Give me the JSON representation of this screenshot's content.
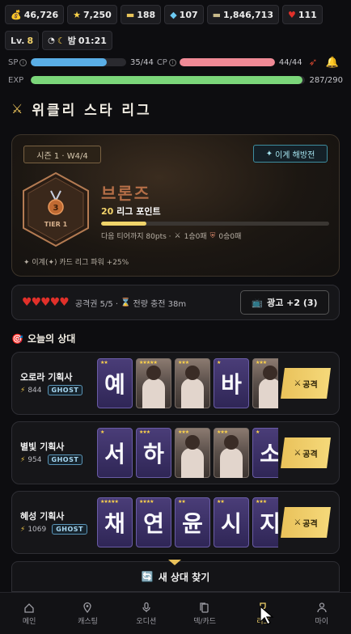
{
  "currencies": {
    "coins": "46,726",
    "stars": "7,250",
    "tickets": "188",
    "gems": "107",
    "cash": "1,846,713",
    "hearts": "111"
  },
  "level": {
    "prefix": "Lv.",
    "value": "8"
  },
  "clock": {
    "period": "밤",
    "time": "01:21"
  },
  "stats": {
    "sp": {
      "label": "SP",
      "text": "35/44",
      "fraction": 0.795,
      "color": "#5aaee6"
    },
    "cp": {
      "label": "CP",
      "text": "44/44",
      "fraction": 1.0,
      "color": "#f08a96"
    },
    "exp": {
      "label": "EXP",
      "text": "287/290",
      "fraction": 0.99,
      "color": "#7bd67a"
    }
  },
  "page": {
    "title": "위클리 스타 리그"
  },
  "league": {
    "season": "시즌 1 · W4/4",
    "ego_button": "이계 해방전",
    "tier_number": "3",
    "tier_label": "TIER 1",
    "tier_name": "브론즈",
    "points_value": "20",
    "points_label": "리그 포인트",
    "progress_fraction": 0.2,
    "next_tier": "다음 티어까지 80pts ·",
    "record1": "1승0패",
    "record2": "0승0패",
    "bonus": "✦ 이계(✦) 카드 리그 파워 +25%"
  },
  "energy": {
    "hearts_count": 5,
    "ticket_text": "공격권 5/5 ·",
    "charge_text": "전량 충전 38m",
    "ad_button": "광고 +2 (3)"
  },
  "opponents_header": "오늘의 상대",
  "opponents": [
    {
      "name": "오로라 기획사",
      "power": "844",
      "badge": "GHOST",
      "attack": "공격",
      "cards": [
        {
          "type": "letter",
          "char": "예",
          "stars": "★★"
        },
        {
          "type": "photo",
          "stars": "★★★★★"
        },
        {
          "type": "photo",
          "stars": "★★★"
        },
        {
          "type": "letter",
          "char": "바",
          "stars": "★"
        },
        {
          "type": "photo",
          "stars": "★★★"
        }
      ]
    },
    {
      "name": "별빛 기획사",
      "power": "954",
      "badge": "GHOST",
      "attack": "공격",
      "cards": [
        {
          "type": "letter",
          "char": "서",
          "stars": "★"
        },
        {
          "type": "letter",
          "char": "하",
          "stars": "★★★"
        },
        {
          "type": "photo",
          "stars": "★★★"
        },
        {
          "type": "photo",
          "stars": "★★★"
        },
        {
          "type": "letter",
          "char": "소",
          "stars": "★"
        }
      ]
    },
    {
      "name": "혜성 기획사",
      "power": "1069",
      "badge": "GHOST",
      "attack": "공격",
      "cards": [
        {
          "type": "letter",
          "char": "채",
          "stars": "★★★★★"
        },
        {
          "type": "letter",
          "char": "연",
          "stars": "★★★★"
        },
        {
          "type": "letter",
          "char": "윤",
          "stars": "★★"
        },
        {
          "type": "letter",
          "char": "시",
          "stars": "★★"
        },
        {
          "type": "letter",
          "char": "지",
          "stars": "★★★"
        }
      ]
    }
  ],
  "find_button": "새 상대 찾기",
  "nav": [
    {
      "label": "메인",
      "icon": "home-icon",
      "active": false
    },
    {
      "label": "캐스팅",
      "icon": "location-pin-icon",
      "active": false
    },
    {
      "label": "오디션",
      "icon": "microphone-icon",
      "active": false
    },
    {
      "label": "덱/카드",
      "icon": "cards-icon",
      "active": false
    },
    {
      "label": "리그",
      "icon": "trophy-icon",
      "active": true
    },
    {
      "label": "마이",
      "icon": "person-icon",
      "active": false
    }
  ],
  "colors": {
    "gold": "#e9c15a",
    "bronze": "#b46e47",
    "background": "#0d0d10"
  }
}
